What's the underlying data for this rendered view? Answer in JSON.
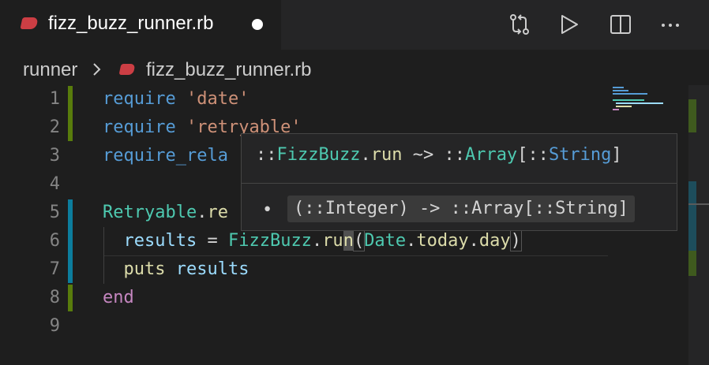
{
  "tab": {
    "filename": "fizz_buzz_runner.rb",
    "dirty_icon": "dot-icon",
    "file_icon": "ruby-icon"
  },
  "toolbar": {
    "icons": [
      "compare-changes-icon",
      "run-icon",
      "split-editor-icon",
      "more-actions-icon"
    ]
  },
  "breadcrumb": {
    "folder": "runner",
    "separator_icon": "chevron-right-icon",
    "file": "fizz_buzz_runner.rb"
  },
  "editor": {
    "line_numbers": [
      "1",
      "2",
      "3",
      "4",
      "5",
      "6",
      "7",
      "8",
      "9"
    ],
    "lines": {
      "l1": {
        "kw": "require",
        "sp": " ",
        "str": "'date'"
      },
      "l2": {
        "kw": "require",
        "sp": " ",
        "str": "'retryable'"
      },
      "l3": {
        "kw": "require_rela"
      },
      "l5": {
        "cls": "Retryable",
        "dot": ".",
        "fn": "re"
      },
      "l6": {
        "indent": "  ",
        "var": "results",
        "eq": " = ",
        "cls": "FizzBuzz",
        "dot": ".",
        "fn1": "ru",
        "fn2": "n",
        "fn3": "",
        "open": "(",
        "cls2": "Date",
        "dot2": ".",
        "fn4": "today",
        "dot3": ".",
        "fn5": "day",
        "close": ")"
      },
      "l7": {
        "indent": "  ",
        "fn": "puts",
        "sp": " ",
        "var": "results"
      },
      "l8": {
        "kw": "end"
      }
    }
  },
  "hover": {
    "signature": {
      "p1": "::",
      "cls1": "FizzBuzz",
      "dot": ".",
      "fn": "run",
      "arrow": " ~> ",
      "p2": "::",
      "cls2": "Array",
      "b1": "[",
      "p3": "::",
      "cls3": "String",
      "b2": "]"
    },
    "bullet": "•",
    "overload": "(::Integer) -> ::Array[::String]"
  },
  "colors": {
    "keyword": "#569cd6",
    "string": "#ce9178",
    "class": "#4ec9b0",
    "function": "#dcdcaa",
    "variable": "#9cdcfe",
    "end_keyword": "#c586c0",
    "ruby": "#cc3e44",
    "gutter_added": "#587c0c",
    "gutter_modified": "#0c7d9d"
  }
}
